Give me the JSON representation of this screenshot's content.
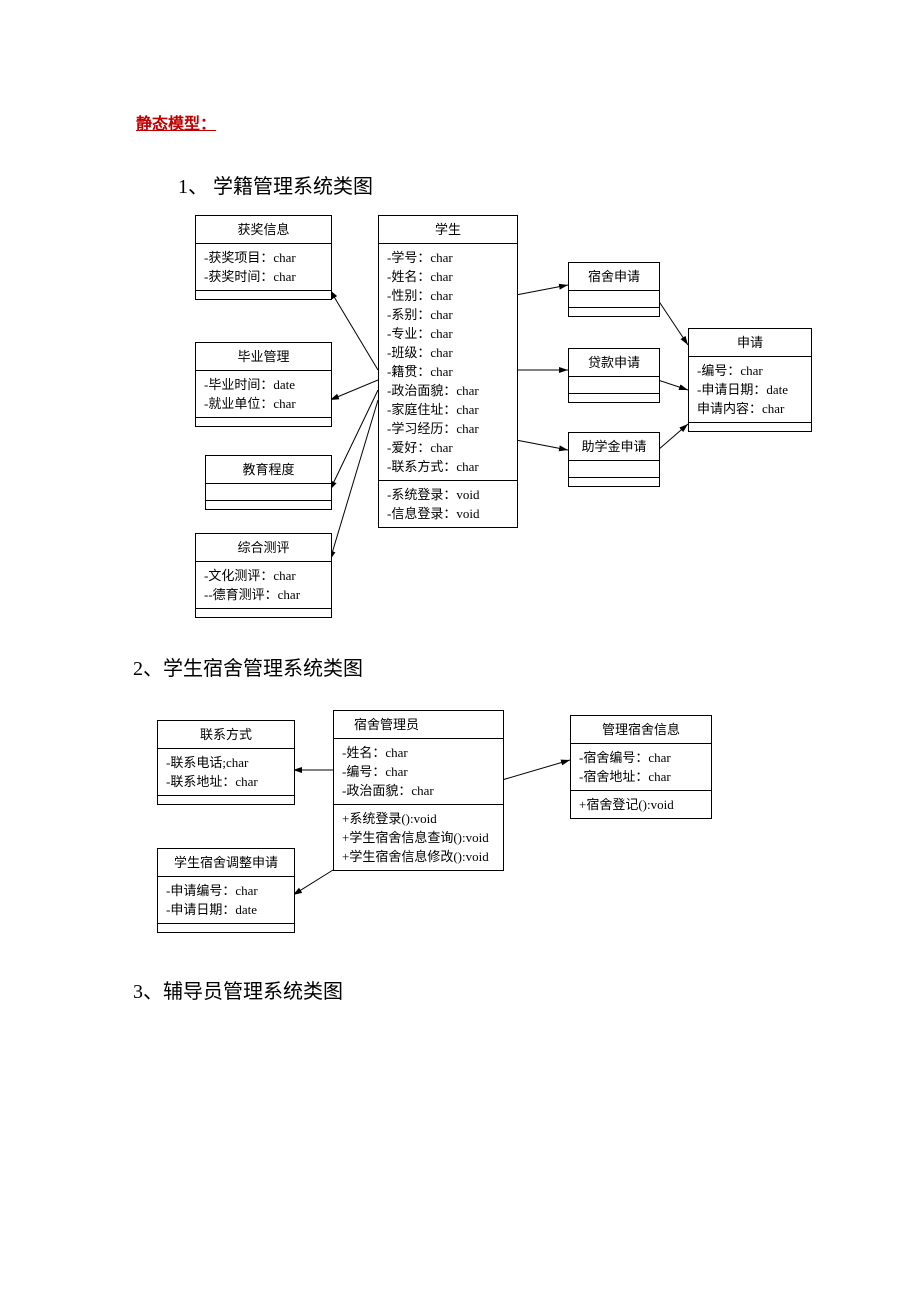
{
  "title": "静态模型：",
  "section1": {
    "heading": "1、  学籍管理系统类图"
  },
  "section2": {
    "heading": "2、学生宿舍管理系统类图"
  },
  "section3": {
    "heading": "3、辅导员管理系统类图"
  },
  "d1": {
    "awardInfo": {
      "name": "获奖信息",
      "a1": "-获奖项目：char",
      "a2": "-获奖时间：char"
    },
    "gradMgmt": {
      "name": "毕业管理",
      "a1": "-毕业时间：date",
      "a2": "-就业单位：char"
    },
    "eduLevel": {
      "name": "教育程度"
    },
    "compEval": {
      "name": "综合测评",
      "a1": "-文化测评：char",
      "a2": "--德育测评：char"
    },
    "student": {
      "name": "学生",
      "a1": "-学号：char",
      "a2": "-姓名：char",
      "a3": "-性别：char",
      "a4": "-系别：char",
      "a5": "-专业：char",
      "a6": "-班级：char",
      "a7": "-籍贯：char",
      "a8": "-政治面貌：char",
      "a9": "-家庭住址：char",
      "a10": "-学习经历：char",
      "a11": "-爱好：char",
      "a12": "-联系方式：char",
      "m1": "-系统登录：void",
      "m2": "-信息登录：void"
    },
    "dormApply": {
      "name": "宿舍申请"
    },
    "loanApply": {
      "name": "贷款申请"
    },
    "grantApply": {
      "name": "助学金申请"
    },
    "apply": {
      "name": "申请",
      "a1": "-编号：char",
      "a2": "-申请日期：date",
      "a3": "申请内容：char"
    }
  },
  "d2": {
    "contact": {
      "name": "联系方式",
      "a1": "-联系电话;char",
      "a2": "-联系地址：char"
    },
    "dormAdjApply": {
      "name": "学生宿舍调整申请",
      "a1": "-申请编号：char",
      "a2": "-申请日期：date"
    },
    "dormAdmin": {
      "name": "宿舍管理员",
      "a1": "-姓名：char",
      "a2": "-编号：char",
      "a3": "-政治面貌：char",
      "m1": "+系统登录():void",
      "m2": "+学生宿舍信息查询():void",
      "m3": "+学生宿舍信息修改():void"
    },
    "dormInfo": {
      "name": "管理宿舍信息",
      "a1": "-宿舍编号：char",
      "a2": "-宿舍地址：char",
      "m1": "+宿舍登记():void"
    }
  }
}
